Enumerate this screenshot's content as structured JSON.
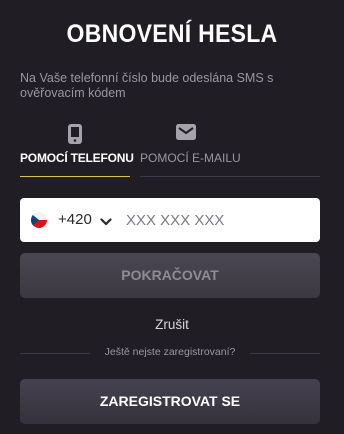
{
  "header": {
    "title": "OBNOVENÍ HESLA"
  },
  "description": "Na Vaše telefonní číslo bude odeslána SMS s ověřovacím kódem",
  "tabs": [
    {
      "label": "POMOCÍ TELEFONU",
      "icon": "phone-icon",
      "active": true
    },
    {
      "label": "POMOCÍ E-MAILU",
      "icon": "envelope-icon",
      "active": false
    }
  ],
  "phone": {
    "country": "cz-flag-icon",
    "prefix": "+420",
    "placeholder": "XXX XXX XXX",
    "value": ""
  },
  "buttons": {
    "continue": "POKRAČOVAT",
    "cancel": "Zrušit",
    "register": "ZAREGISTROVAT SE"
  },
  "register_prompt": "Ještě nejste zaregistrovaní?",
  "colors": {
    "background": "#201d25",
    "accent": "#d9c14a",
    "button": "#403d47"
  }
}
